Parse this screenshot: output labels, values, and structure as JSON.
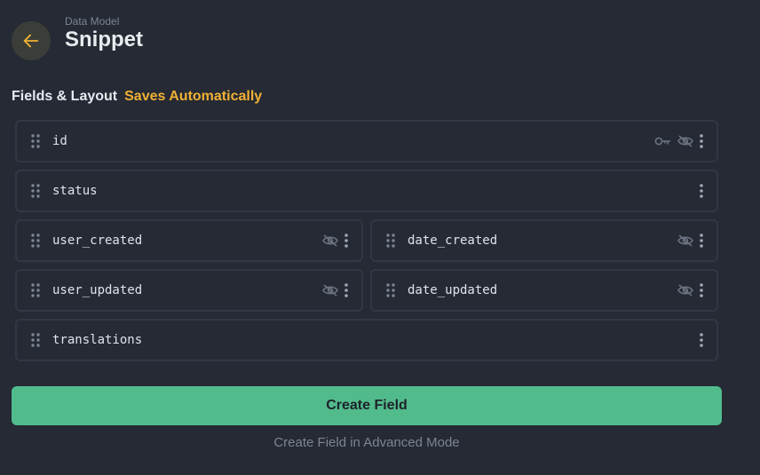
{
  "header": {
    "breadcrumb": "Data Model",
    "title": "Snippet",
    "back_icon": "arrow-left-icon",
    "accent_color": "#f0b034"
  },
  "section": {
    "title": "Fields & Layout",
    "status": "Saves Automatically"
  },
  "fields": [
    {
      "name": "id",
      "icons": [
        "key-icon",
        "hidden-icon",
        "more-vert-icon"
      ]
    },
    {
      "name": "status",
      "icons": [
        "more-vert-icon"
      ]
    },
    {
      "name": "user_created",
      "icons": [
        "hidden-icon",
        "more-vert-icon"
      ]
    },
    {
      "name": "date_created",
      "icons": [
        "hidden-icon",
        "more-vert-icon"
      ]
    },
    {
      "name": "user_updated",
      "icons": [
        "hidden-icon",
        "more-vert-icon"
      ]
    },
    {
      "name": "date_updated",
      "icons": [
        "hidden-icon",
        "more-vert-icon"
      ]
    },
    {
      "name": "translations",
      "icons": [
        "more-vert-icon"
      ]
    }
  ],
  "actions": {
    "create_field": "Create Field",
    "create_advanced": "Create Field in Advanced Mode",
    "primary_color": "#52bb8c"
  }
}
